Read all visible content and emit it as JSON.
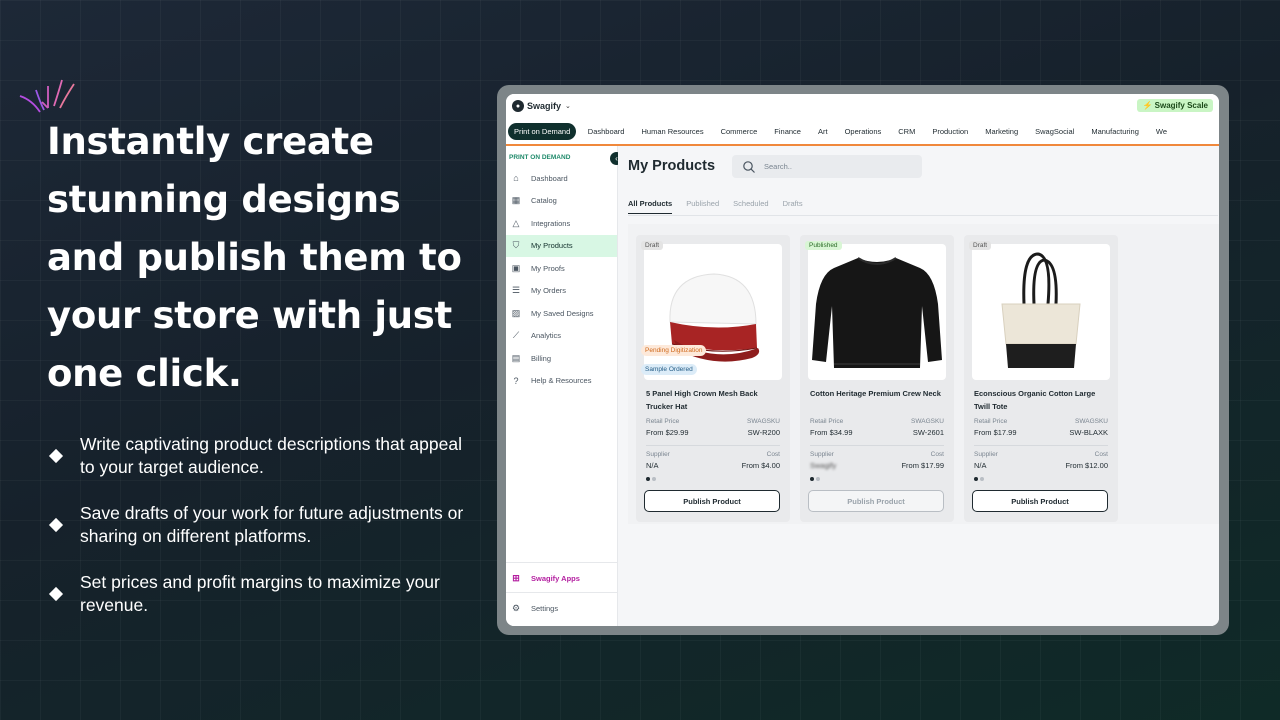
{
  "hero": {
    "headline": "Instantly create stunning designs and publish them to your store with just one click.",
    "bullets": [
      "Write captivating product descriptions that appeal to your target audience.",
      "Save drafts of your work for future adjustments or sharing on different platforms.",
      "Set prices and profit margins to maximize your revenue."
    ]
  },
  "app": {
    "brand": "Swagify",
    "scale_badge": "Swagify Scale",
    "nav": [
      "Print on Demand",
      "Dashboard",
      "Human Resources",
      "Commerce",
      "Finance",
      "Art",
      "Operations",
      "CRM",
      "Production",
      "Marketing",
      "SwagSocial",
      "Manufacturing",
      "We"
    ],
    "sidebar": {
      "section": "PRINT ON DEMAND",
      "items": [
        {
          "label": "Dashboard",
          "icon": "home-icon"
        },
        {
          "label": "Catalog",
          "icon": "grid-icon"
        },
        {
          "label": "Integrations",
          "icon": "shapes-icon"
        },
        {
          "label": "My Products",
          "icon": "shirt-icon"
        },
        {
          "label": "My Proofs",
          "icon": "proof-icon"
        },
        {
          "label": "My Orders",
          "icon": "list-icon"
        },
        {
          "label": "My Saved Designs",
          "icon": "image-icon"
        },
        {
          "label": "Analytics",
          "icon": "chart-icon"
        },
        {
          "label": "Billing",
          "icon": "document-icon"
        },
        {
          "label": "Help & Resources",
          "icon": "help-icon"
        }
      ],
      "apps": "Swagify Apps",
      "settings": "Settings"
    },
    "main": {
      "title": "My Products",
      "search_placeholder": "Search..",
      "tabs": [
        "All Products",
        "Published",
        "Scheduled",
        "Drafts"
      ]
    },
    "labels": {
      "retail_price": "Retail Price",
      "swagsku": "SWAGSKU",
      "supplier": "Supplier",
      "cost": "Cost",
      "publish": "Publish Product"
    },
    "products": [
      {
        "status": "Draft",
        "name": "5 Panel High Crown Mesh Back Trucker Hat",
        "price": "From $29.99",
        "sku": "SW-R200",
        "supplier": "N/A",
        "cost": "From $4.00",
        "pending": "Pending Digitization",
        "sample": "Sample Ordered"
      },
      {
        "status": "Published",
        "name": "Cotton Heritage Premium Crew Neck",
        "price": "From $34.99",
        "sku": "SW-2601",
        "supplier": "Swagify",
        "cost": "From $17.99"
      },
      {
        "status": "Draft",
        "name": "Econscious Organic Cotton Large Twill Tote",
        "price": "From $17.99",
        "sku": "SW-BLAXK",
        "supplier": "N/A",
        "cost": "From $12.00"
      }
    ]
  }
}
